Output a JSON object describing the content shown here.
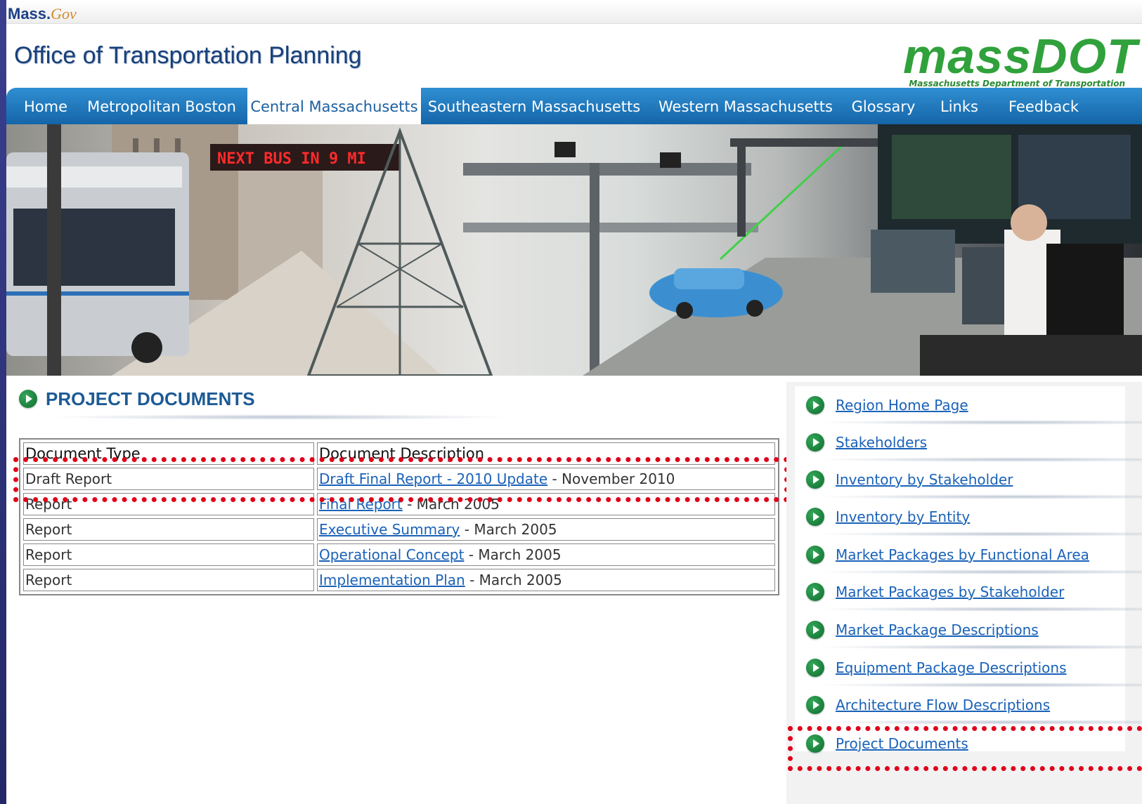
{
  "gov_logo": {
    "mass": "Mass.",
    "gov": "Gov"
  },
  "header": {
    "title": "Office of Transportation Planning",
    "logo_text": "massDOT",
    "logo_subtext": "Massachusetts Department of Transportation"
  },
  "nav": {
    "items": [
      {
        "label": "Home"
      },
      {
        "label": "Metropolitan Boston"
      },
      {
        "label": "Central Massachusetts",
        "active": true
      },
      {
        "label": "Southeastern Massachusetts"
      },
      {
        "label": "Western Massachusetts"
      },
      {
        "label": "Glossary"
      },
      {
        "label": "Links"
      },
      {
        "label": "Feedback"
      }
    ]
  },
  "banner": {
    "sign_text": "NEXT BUS IN 9 MI"
  },
  "section": {
    "title": "PROJECT DOCUMENTS"
  },
  "table": {
    "headers": [
      "Document Type",
      "Document Description"
    ],
    "rows": [
      {
        "type": "Draft Report",
        "link": "Draft Final Report - 2010 Update",
        "date": " - November 2010"
      },
      {
        "type": "Report",
        "link": "Final Report",
        "date": " - March 2005"
      },
      {
        "type": "Report",
        "link": "Executive Summary",
        "date": " - March 2005"
      },
      {
        "type": "Report",
        "link": "Operational Concept",
        "date": " - March 2005"
      },
      {
        "type": "Report",
        "link": "Implementation Plan",
        "date": " - March 2005"
      }
    ]
  },
  "sidebar": {
    "items": [
      {
        "label": "Region Home Page"
      },
      {
        "label": "Stakeholders"
      },
      {
        "label": "Inventory by Stakeholder"
      },
      {
        "label": "Inventory by Entity"
      },
      {
        "label": "Market Packages by Functional Area"
      },
      {
        "label": "Market Packages by Stakeholder"
      },
      {
        "label": "Market Package Descriptions"
      },
      {
        "label": "Equipment Package Descriptions"
      },
      {
        "label": "Architecture Flow Descriptions"
      },
      {
        "label": "Project Documents"
      }
    ]
  },
  "colors": {
    "nav_blue": "#1e78c2",
    "link_blue": "#1a62b8",
    "massdot_green": "#30a13b",
    "highlight_red": "#e0001a",
    "icon_green": "#0f6d2d"
  }
}
